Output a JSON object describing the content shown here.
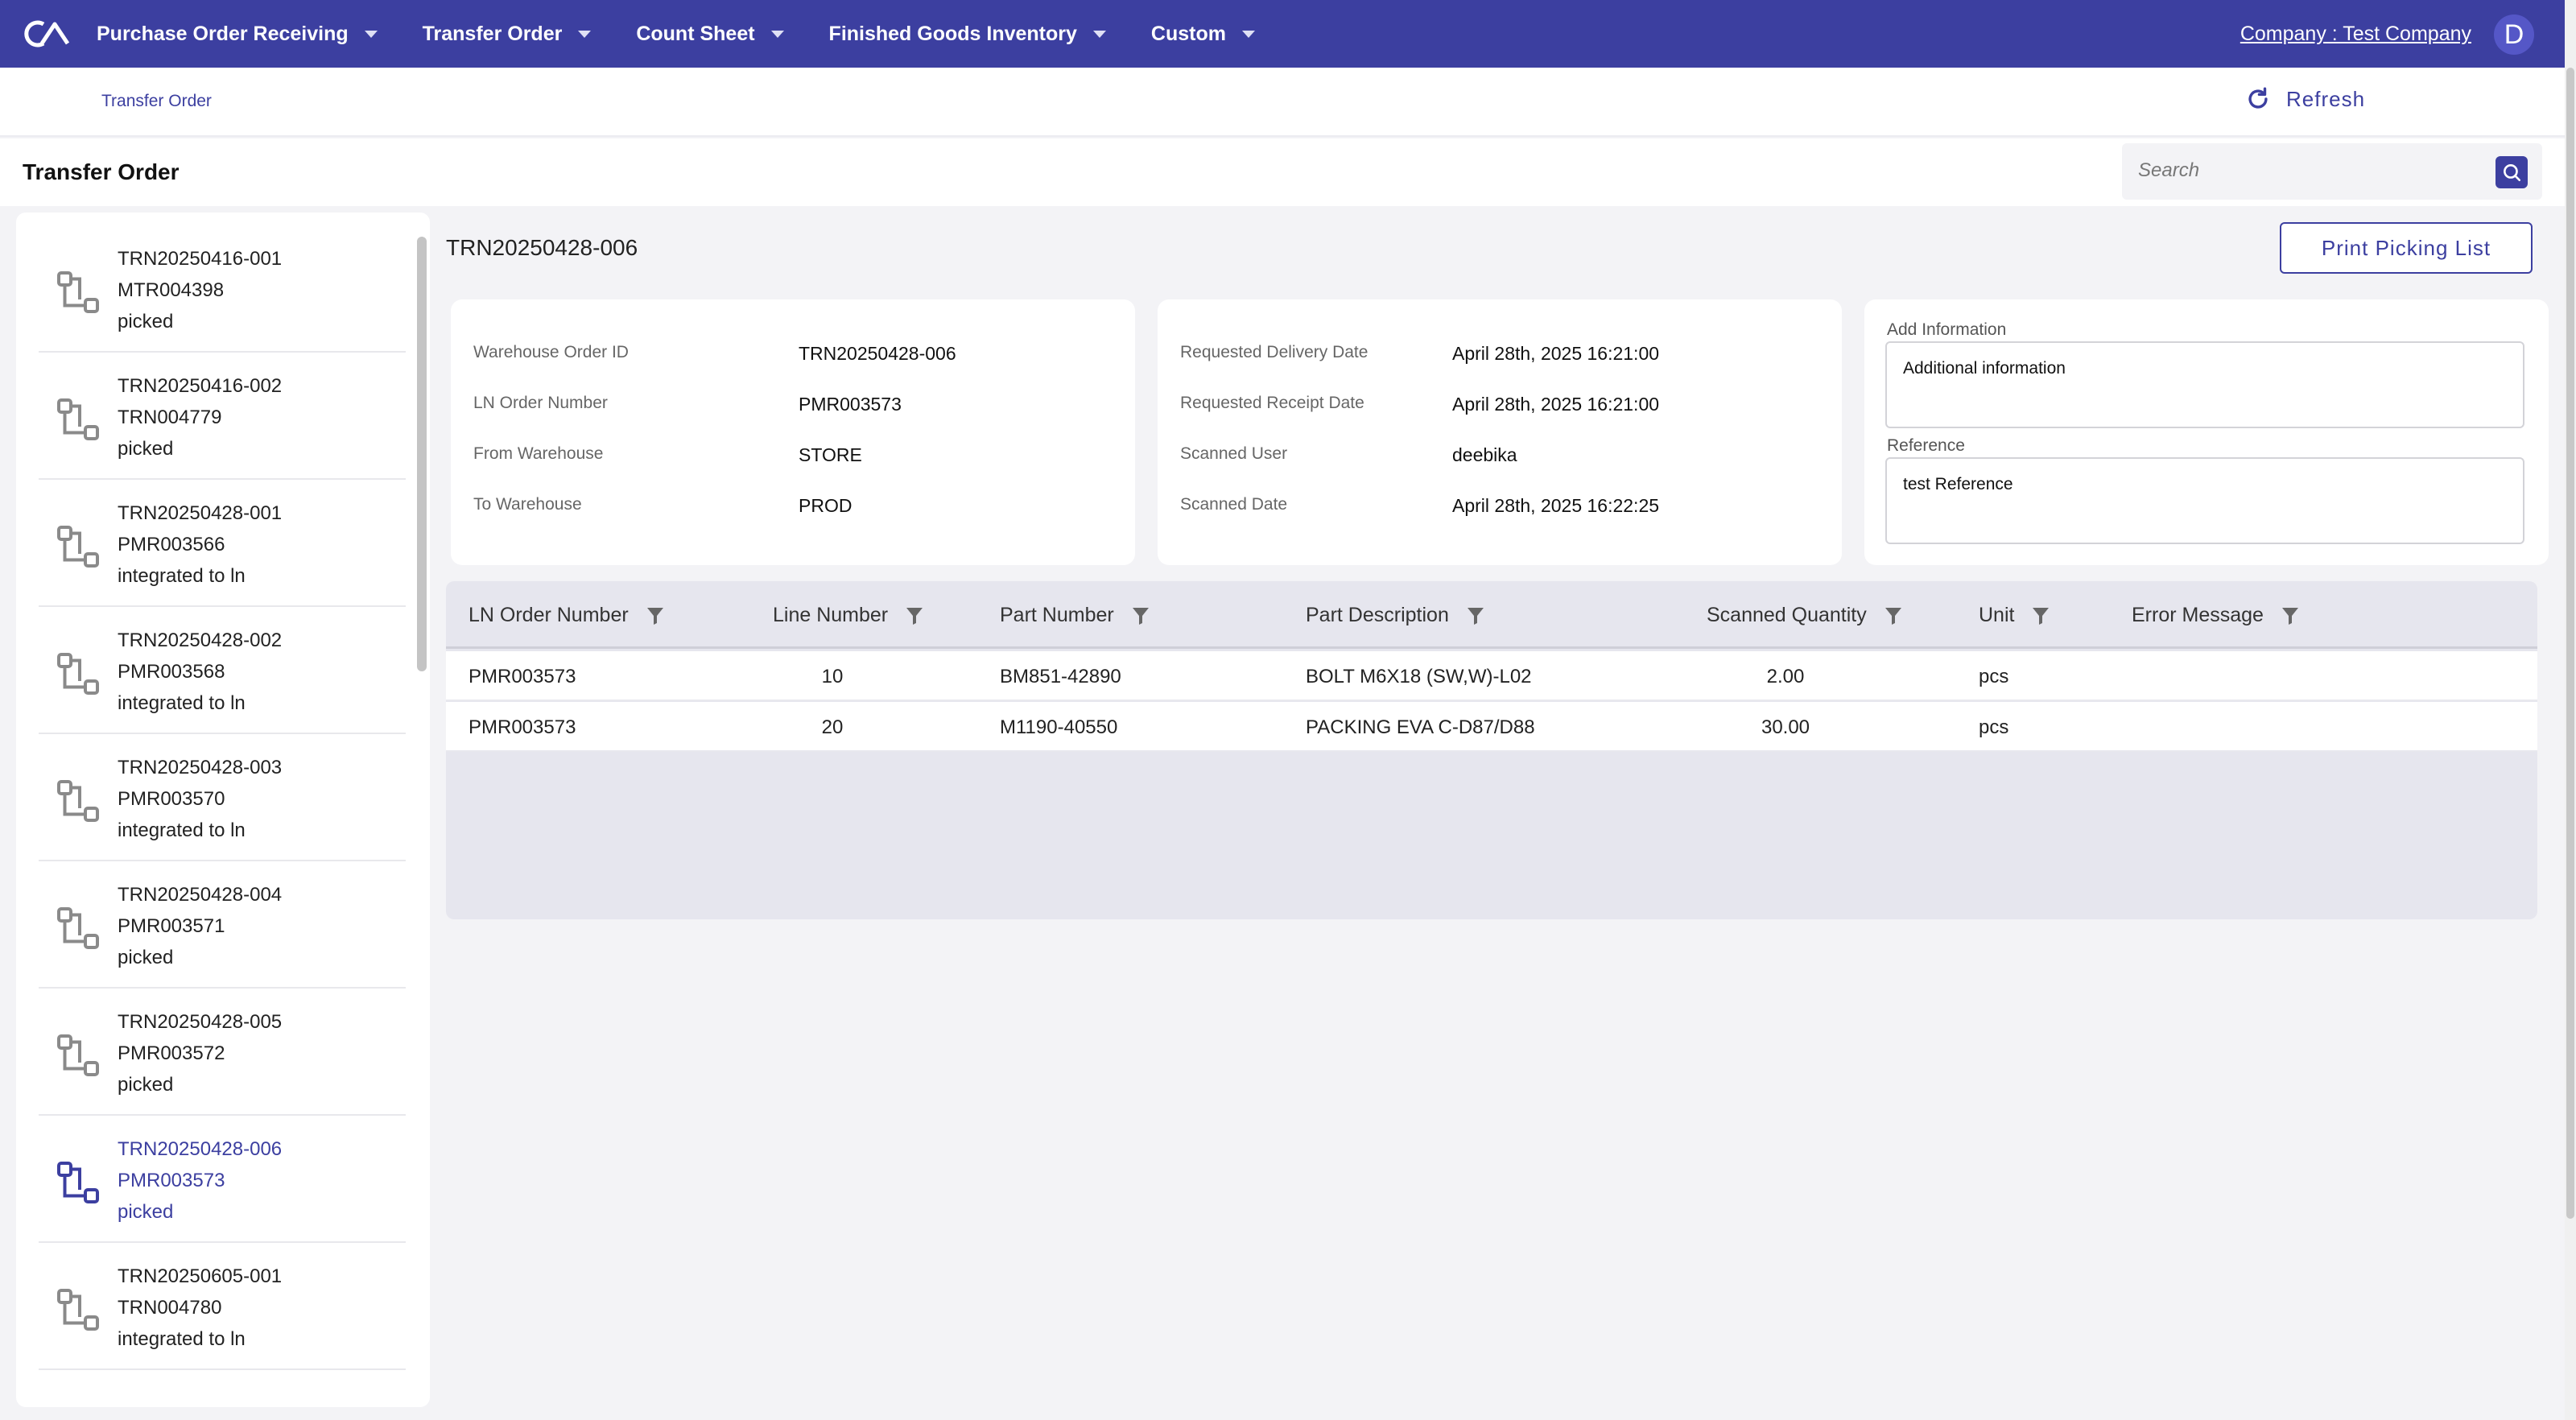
{
  "nav": {
    "items": [
      {
        "label": "Purchase Order Receiving"
      },
      {
        "label": "Transfer Order"
      },
      {
        "label": "Count Sheet"
      },
      {
        "label": "Finished Goods Inventory"
      },
      {
        "label": "Custom"
      }
    ],
    "company": "Company : Test Company",
    "avatar": "D",
    "logo_icon": "ca-logo-icon"
  },
  "breadcrumb": "Transfer Order",
  "refresh_label": "Refresh",
  "page_title": "Transfer Order",
  "search": {
    "placeholder": "Search",
    "value": ""
  },
  "list": [
    {
      "id": "TRN20250416-001",
      "order": "MTR004398",
      "status": "picked"
    },
    {
      "id": "TRN20250416-002",
      "order": "TRN004779",
      "status": "picked"
    },
    {
      "id": "TRN20250428-001",
      "order": "PMR003566",
      "status": "integrated to ln"
    },
    {
      "id": "TRN20250428-002",
      "order": "PMR003568",
      "status": "integrated to ln"
    },
    {
      "id": "TRN20250428-003",
      "order": "PMR003570",
      "status": "integrated to ln"
    },
    {
      "id": "TRN20250428-004",
      "order": "PMR003571",
      "status": "picked"
    },
    {
      "id": "TRN20250428-005",
      "order": "PMR003572",
      "status": "picked"
    },
    {
      "id": "TRN20250428-006",
      "order": "PMR003573",
      "status": "picked",
      "active": true
    },
    {
      "id": "TRN20250605-001",
      "order": "TRN004780",
      "status": "integrated to ln"
    }
  ],
  "detail": {
    "title": "TRN20250428-006",
    "print_label": "Print Picking List",
    "card1": [
      {
        "label": "Warehouse Order ID",
        "value": "TRN20250428-006"
      },
      {
        "label": "LN Order Number",
        "value": "PMR003573"
      },
      {
        "label": "From Warehouse",
        "value": "STORE"
      },
      {
        "label": "To Warehouse",
        "value": "PROD"
      }
    ],
    "card2": [
      {
        "label": "Requested Delivery Date",
        "value": "April 28th, 2025 16:21:00"
      },
      {
        "label": "Requested Receipt Date",
        "value": "April 28th, 2025 16:21:00"
      },
      {
        "label": "Scanned User",
        "value": "deebika"
      },
      {
        "label": "Scanned Date",
        "value": "April 28th, 2025 16:22:25"
      }
    ],
    "add_info_label": "Add Information",
    "add_info_value": "Additional information",
    "reference_label": "Reference",
    "reference_value": "test Reference"
  },
  "table": {
    "columns": [
      "LN Order Number",
      "Line Number",
      "Part Number",
      "Part Description",
      "Scanned Quantity",
      "Unit",
      "Error Message"
    ],
    "rows": [
      [
        "PMR003573",
        "10",
        "BM851-42890",
        "BOLT M6X18 (SW,W)-L02",
        "2.00",
        "pcs",
        ""
      ],
      [
        "PMR003573",
        "20",
        "M1190-40550",
        "PACKING EVA C-D87/D88",
        "30.00",
        "pcs",
        ""
      ]
    ]
  },
  "colors": {
    "brand": "#3c3fa0",
    "background": "#f3f3f6"
  }
}
